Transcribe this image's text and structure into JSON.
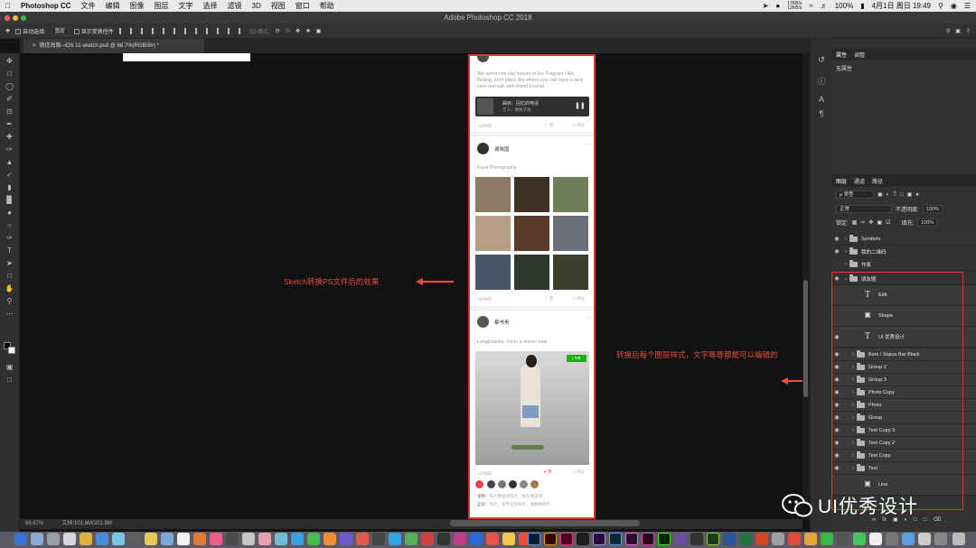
{
  "menubar": {
    "app": "Photoshop CC",
    "items": [
      "文件",
      "编辑",
      "图像",
      "图层",
      "文字",
      "选择",
      "滤镜",
      "3D",
      "视图",
      "窗口",
      "帮助"
    ],
    "net_up": "17KB/s",
    "net_down": "12KB/s",
    "battery": "100%",
    "datetime": "4月1日 周日 19:49"
  },
  "window": {
    "title": "Adobe Photoshop CC 2018"
  },
  "options_bar": {
    "auto_select_label": "自动选择:",
    "auto_select_value": "图层",
    "show_transform_label": "显示变换控件",
    "mode_3d": "3D 模式:"
  },
  "document_tab": {
    "title": "微信改版--iOS 11-sketch.psd @ 66.7%(RGB/8#) *"
  },
  "status_bar": {
    "zoom": "66.67%",
    "doc_size": "文档:101.6M/201.8M"
  },
  "panels": {
    "properties_tabs": [
      "属性",
      "调整"
    ],
    "properties_empty": "无属性",
    "layers_tabs": [
      "图层",
      "通道",
      "路径"
    ],
    "filter_label": "ρ 类型",
    "blend_mode": "正常",
    "opacity_label": "不透明度:",
    "opacity_value": "100%",
    "lock_label": "锁定:",
    "fill_label": "填充:",
    "fill_value": "100%"
  },
  "layers": [
    {
      "name": "Symbols",
      "kind": "group",
      "indent": 0
    },
    {
      "name": "我的二维码",
      "kind": "group",
      "indent": 0
    },
    {
      "name": "作废",
      "kind": "group",
      "indent": 0
    },
    {
      "name": "朋友圈",
      "kind": "group",
      "indent": 0,
      "open": true
    },
    {
      "name": "Edit",
      "kind": "text",
      "indent": 1
    },
    {
      "name": "Shape",
      "kind": "shape",
      "indent": 1
    },
    {
      "name": "UI 优秀设计",
      "kind": "text",
      "indent": 1
    },
    {
      "name": "Bars / Status Bar Black",
      "kind": "group",
      "indent": 1
    },
    {
      "name": "Group 2",
      "kind": "group",
      "indent": 1
    },
    {
      "name": "Group 3",
      "kind": "group",
      "indent": 1
    },
    {
      "name": "Photo Copy",
      "kind": "group",
      "indent": 1
    },
    {
      "name": "Photo",
      "kind": "group",
      "indent": 1
    },
    {
      "name": "Group",
      "kind": "group",
      "indent": 1
    },
    {
      "name": "Text Copy 3",
      "kind": "group",
      "indent": 1
    },
    {
      "name": "Text Copy 2",
      "kind": "group",
      "indent": 1
    },
    {
      "name": "Text Copy",
      "kind": "group",
      "indent": 1
    },
    {
      "name": "Text",
      "kind": "group",
      "indent": 1
    },
    {
      "name": "Line",
      "kind": "shape",
      "indent": 1
    }
  ],
  "annotations": {
    "left": "Sketch转换PS文件后的效果",
    "right": "转换后每个图层样式，文字等等都是可以编辑的"
  },
  "phone": {
    "post1_text": "We spent one day leisure in the Fragrant Hills, Beijing. Find place like where you can have a best view and talk with friend Enshal",
    "music_title": "曲目：回忆的电话",
    "music_artist": "艺人：佩佩子佑",
    "post1_time": "1分钟前",
    "like": "赞",
    "comment": "评论",
    "post2_name": "谢晓国",
    "post2_text": "Food Photography",
    "post2_time": "1分钟前",
    "post3_name": "蔡书贵",
    "post3_text": "Longboarder. I'm in a dream now",
    "live_badge": "LIVE",
    "post3_time": "1分钟前",
    "comment1_name": "张锦：",
    "comment1_text": "照片整理得很好，你在哪里啊。",
    "comment2_name": "蓝早：",
    "comment2_text": "附近，很专业的照片，我要跟你学。"
  },
  "watermark": {
    "text": "UI优秀设计"
  },
  "colors": {
    "accent_red": "#d83a2b",
    "ps_bg": "#323232",
    "canvas": "#121212"
  }
}
